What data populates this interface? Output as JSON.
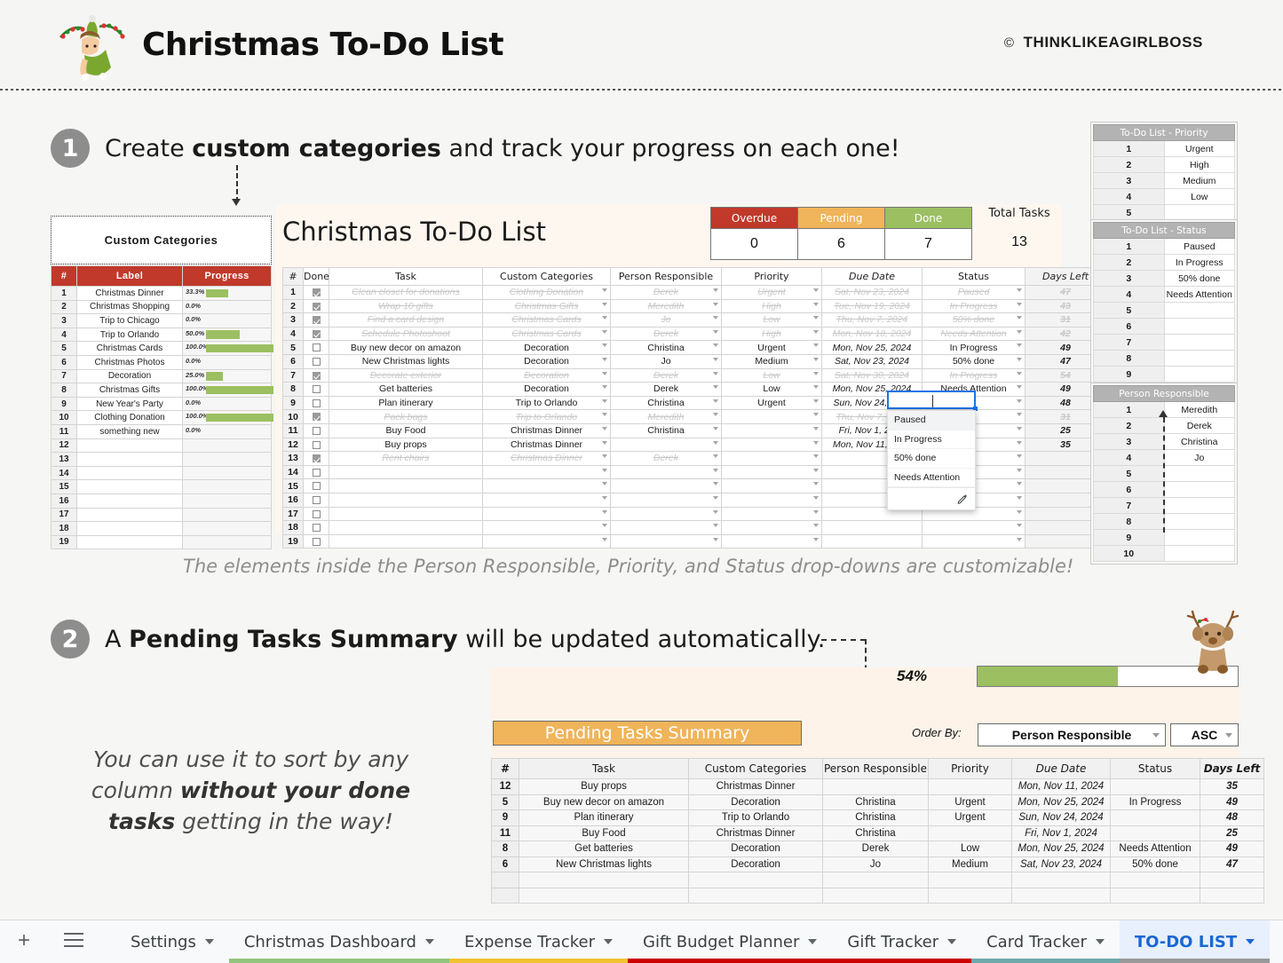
{
  "header": {
    "title": "Christmas To-Do List",
    "brand": "THINKLIKEAGIRLBOSS",
    "copyright": "©"
  },
  "steps": [
    {
      "number": "1",
      "text_before": "Create ",
      "text_bold": "custom categories",
      "text_after": " and track your progress on each one!"
    },
    {
      "number": "2",
      "text_before": "A ",
      "text_bold": "Pending Tasks Summary",
      "text_after": " will be updated automatically."
    }
  ],
  "captions": {
    "dropdown_note": "The elements inside the Person Responsible, Priority, and Status drop-downs are customizable!",
    "sort_note_1": "You can use it to sort by any",
    "sort_note_2a": "column ",
    "sort_note_2b": "without your done",
    "sort_note_3a": "tasks",
    "sort_note_3b": " getting in the way!"
  },
  "custom_categories": {
    "box_label": "Custom Categories",
    "columns": [
      "#",
      "Label",
      "Progress"
    ],
    "rows": [
      {
        "n": "1",
        "label": "Christmas Dinner",
        "pct": "33.3%",
        "value": 33.3
      },
      {
        "n": "2",
        "label": "Christmas Shopping",
        "pct": "0.0%",
        "value": 0
      },
      {
        "n": "3",
        "label": "Trip to Chicago",
        "pct": "0.0%",
        "value": 0
      },
      {
        "n": "4",
        "label": "Trip to Orlando",
        "pct": "50.0%",
        "value": 50
      },
      {
        "n": "5",
        "label": "Christmas Cards",
        "pct": "100.0%",
        "value": 100
      },
      {
        "n": "6",
        "label": "Christmas Photos",
        "pct": "0.0%",
        "value": 0
      },
      {
        "n": "7",
        "label": "Decoration",
        "pct": "25.0%",
        "value": 25
      },
      {
        "n": "8",
        "label": "Christmas Gifts",
        "pct": "100.0%",
        "value": 100
      },
      {
        "n": "9",
        "label": "New Year's Party",
        "pct": "0.0%",
        "value": 0
      },
      {
        "n": "10",
        "label": "Clothing Donation",
        "pct": "100.0%",
        "value": 100
      },
      {
        "n": "11",
        "label": "something new",
        "pct": "0.0%",
        "value": 0
      },
      {
        "n": "12",
        "label": "",
        "pct": "",
        "value": 0
      },
      {
        "n": "13",
        "label": "",
        "pct": "",
        "value": 0
      },
      {
        "n": "14",
        "label": "",
        "pct": "",
        "value": 0
      },
      {
        "n": "15",
        "label": "",
        "pct": "",
        "value": 0
      },
      {
        "n": "16",
        "label": "",
        "pct": "",
        "value": 0
      },
      {
        "n": "17",
        "label": "",
        "pct": "",
        "value": 0
      },
      {
        "n": "18",
        "label": "",
        "pct": "",
        "value": 0
      },
      {
        "n": "19",
        "label": "",
        "pct": "",
        "value": 0
      }
    ]
  },
  "main_sheet": {
    "title": "Christmas To-Do List",
    "kpi": [
      {
        "label": "Overdue",
        "value": "0",
        "color": "#c0392b"
      },
      {
        "label": "Pending",
        "value": "6",
        "color": "#f0b45a"
      },
      {
        "label": "Done",
        "value": "7",
        "color": "#9cbf62"
      }
    ],
    "total_label": "Total Tasks",
    "total_value": "13",
    "columns": [
      "#",
      "Done",
      "Task",
      "Custom Categories",
      "Person Responsible",
      "Priority",
      "Due Date",
      "Status",
      "Days Left"
    ],
    "rows": [
      {
        "n": "1",
        "done": true,
        "task": "Clean closet for donations",
        "cat": "Clothing Donation",
        "person": "Derek",
        "priority": "Urgent",
        "due": "Sat, Nov 23, 2024",
        "status": "Paused",
        "days": "47"
      },
      {
        "n": "2",
        "done": true,
        "task": "Wrap 10 gifts",
        "cat": "Christmas Gifts",
        "person": "Meredith",
        "priority": "High",
        "due": "Tue, Nov 19, 2024",
        "status": "In Progress",
        "days": "43"
      },
      {
        "n": "3",
        "done": true,
        "task": "Find a card design",
        "cat": "Christmas Cards",
        "person": "Jo",
        "priority": "Low",
        "due": "Thu, Nov 7, 2024",
        "status": "50% done",
        "days": "31"
      },
      {
        "n": "4",
        "done": true,
        "task": "Schedule Photoshoot",
        "cat": "Christmas Cards",
        "person": "Derek",
        "priority": "High",
        "due": "Mon, Nov 18, 2024",
        "status": "Needs Attention",
        "days": "42"
      },
      {
        "n": "5",
        "done": false,
        "task": "Buy new decor on amazon",
        "cat": "Decoration",
        "person": "Christina",
        "priority": "Urgent",
        "due": "Mon, Nov 25, 2024",
        "status": "In Progress",
        "days": "49"
      },
      {
        "n": "6",
        "done": false,
        "task": "New Christmas lights",
        "cat": "Decoration",
        "person": "Jo",
        "priority": "Medium",
        "due": "Sat, Nov 23, 2024",
        "status": "50% done",
        "days": "47"
      },
      {
        "n": "7",
        "done": true,
        "task": "Decorate exterior",
        "cat": "Decoration",
        "person": "Derek",
        "priority": "Low",
        "due": "Sat, Nov 30, 2024",
        "status": "In Progress",
        "days": "54"
      },
      {
        "n": "8",
        "done": false,
        "task": "Get batteries",
        "cat": "Decoration",
        "person": "Derek",
        "priority": "Low",
        "due": "Mon, Nov 25, 2024",
        "status": "Needs Attention",
        "days": "49"
      },
      {
        "n": "9",
        "done": false,
        "task": "Plan itinerary",
        "cat": "Trip to Orlando",
        "person": "Christina",
        "priority": "Urgent",
        "due": "Sun, Nov 24, 2024",
        "status": "",
        "days": "48"
      },
      {
        "n": "10",
        "done": true,
        "task": "Pack bags",
        "cat": "Trip to Orlando",
        "person": "Meredith",
        "priority": "",
        "due": "Thu, Nov 7, 2024",
        "status": "",
        "days": "31"
      },
      {
        "n": "11",
        "done": false,
        "task": "Buy Food",
        "cat": "Christmas Dinner",
        "person": "Christina",
        "priority": "",
        "due": "Fri, Nov 1, 2024",
        "status": "",
        "days": "25"
      },
      {
        "n": "12",
        "done": false,
        "task": "Buy props",
        "cat": "Christmas Dinner",
        "person": "",
        "priority": "",
        "due": "Mon, Nov 11, 2024",
        "status": "",
        "days": "35"
      },
      {
        "n": "13",
        "done": true,
        "task": "Rent chairs",
        "cat": "Christmas Dinner",
        "person": "Derek",
        "priority": "",
        "due": "",
        "status": "",
        "days": ""
      },
      {
        "n": "14",
        "done": false,
        "task": "",
        "cat": "",
        "person": "",
        "priority": "",
        "due": "",
        "status": "",
        "days": ""
      },
      {
        "n": "15",
        "done": false,
        "task": "",
        "cat": "",
        "person": "",
        "priority": "",
        "due": "",
        "status": "",
        "days": ""
      },
      {
        "n": "16",
        "done": false,
        "task": "",
        "cat": "",
        "person": "",
        "priority": "",
        "due": "",
        "status": "",
        "days": ""
      },
      {
        "n": "17",
        "done": false,
        "task": "",
        "cat": "",
        "person": "",
        "priority": "",
        "due": "",
        "status": "",
        "days": ""
      },
      {
        "n": "18",
        "done": false,
        "task": "",
        "cat": "",
        "person": "",
        "priority": "",
        "due": "",
        "status": "",
        "days": ""
      },
      {
        "n": "19",
        "done": false,
        "task": "",
        "cat": "",
        "person": "",
        "priority": "",
        "due": "",
        "status": "",
        "days": ""
      }
    ]
  },
  "status_dropdown": {
    "input_value": "",
    "options": [
      "Paused",
      "In Progress",
      "50% done",
      "Needs Attention"
    ],
    "edit_icon": "pencil-icon"
  },
  "lookups": [
    {
      "title": "To-Do List - Priority",
      "rows": [
        {
          "n": "1",
          "v": "Urgent"
        },
        {
          "n": "2",
          "v": "High"
        },
        {
          "n": "3",
          "v": "Medium"
        },
        {
          "n": "4",
          "v": "Low"
        },
        {
          "n": "5",
          "v": ""
        }
      ]
    },
    {
      "title": "To-Do List - Status",
      "rows": [
        {
          "n": "1",
          "v": "Paused"
        },
        {
          "n": "2",
          "v": "In Progress"
        },
        {
          "n": "3",
          "v": "50% done"
        },
        {
          "n": "4",
          "v": "Needs Attention"
        },
        {
          "n": "5",
          "v": ""
        },
        {
          "n": "6",
          "v": ""
        },
        {
          "n": "7",
          "v": ""
        },
        {
          "n": "8",
          "v": ""
        },
        {
          "n": "9",
          "v": ""
        },
        {
          "n": "10",
          "v": ""
        }
      ]
    },
    {
      "title": "Person Responsible",
      "rows": [
        {
          "n": "1",
          "v": "Meredith"
        },
        {
          "n": "2",
          "v": "Derek"
        },
        {
          "n": "3",
          "v": "Christina"
        },
        {
          "n": "4",
          "v": "Jo"
        },
        {
          "n": "5",
          "v": ""
        },
        {
          "n": "6",
          "v": ""
        },
        {
          "n": "7",
          "v": ""
        },
        {
          "n": "8",
          "v": ""
        },
        {
          "n": "9",
          "v": ""
        },
        {
          "n": "10",
          "v": ""
        }
      ]
    }
  ],
  "pending": {
    "title": "Pending Tasks Summary",
    "progress_pct_label": "54%",
    "progress_value": 54,
    "order_by_label": "Order By:",
    "order_by_value": "Person Responsible",
    "order_dir_value": "ASC",
    "columns": [
      "#",
      "Task",
      "Custom Categories",
      "Person Responsible",
      "Priority",
      "Due Date",
      "Status",
      "Days Left"
    ],
    "rows": [
      {
        "n": "12",
        "task": "Buy props",
        "cat": "Christmas Dinner",
        "person": "",
        "priority": "",
        "due": "Mon, Nov 11, 2024",
        "status": "",
        "days": "35"
      },
      {
        "n": "5",
        "task": "Buy new decor on amazon",
        "cat": "Decoration",
        "person": "Christina",
        "priority": "Urgent",
        "due": "Mon, Nov 25, 2024",
        "status": "In Progress",
        "days": "49"
      },
      {
        "n": "9",
        "task": "Plan itinerary",
        "cat": "Trip to Orlando",
        "person": "Christina",
        "priority": "Urgent",
        "due": "Sun, Nov 24, 2024",
        "status": "",
        "days": "48"
      },
      {
        "n": "11",
        "task": "Buy Food",
        "cat": "Christmas Dinner",
        "person": "Christina",
        "priority": "",
        "due": "Fri, Nov 1, 2024",
        "status": "",
        "days": "25"
      },
      {
        "n": "8",
        "task": "Get batteries",
        "cat": "Decoration",
        "person": "Derek",
        "priority": "Low",
        "due": "Mon, Nov 25, 2024",
        "status": "Needs Attention",
        "days": "49"
      },
      {
        "n": "6",
        "task": "New Christmas lights",
        "cat": "Decoration",
        "person": "Jo",
        "priority": "Medium",
        "due": "Sat, Nov 23, 2024",
        "status": "50% done",
        "days": "47"
      },
      {
        "n": "",
        "task": "",
        "cat": "",
        "person": "",
        "priority": "",
        "due": "",
        "status": "",
        "days": ""
      },
      {
        "n": "",
        "task": "",
        "cat": "",
        "person": "",
        "priority": "",
        "due": "",
        "status": "",
        "days": ""
      }
    ]
  },
  "tabbar": {
    "add_label": "+",
    "tabs": [
      {
        "label": "Settings",
        "color": "transparent",
        "active": false
      },
      {
        "label": "Christmas Dashboard",
        "color": "#93c47d",
        "active": false
      },
      {
        "label": "Expense Tracker",
        "color": "#f1c232",
        "active": false
      },
      {
        "label": "Gift Budget Planner",
        "color": "#cc0000",
        "active": false
      },
      {
        "label": "Gift Tracker",
        "color": "#cc0000",
        "active": false
      },
      {
        "label": "Card Tracker",
        "color": "#6fa8a8",
        "active": false
      },
      {
        "label": "TO-DO LIST",
        "color": "#999999",
        "active": true
      }
    ]
  },
  "colors": {
    "accent_red": "#c0392b",
    "accent_green": "#9cbf62",
    "accent_orange": "#f0b45a",
    "active_tab": "#1967d2"
  }
}
